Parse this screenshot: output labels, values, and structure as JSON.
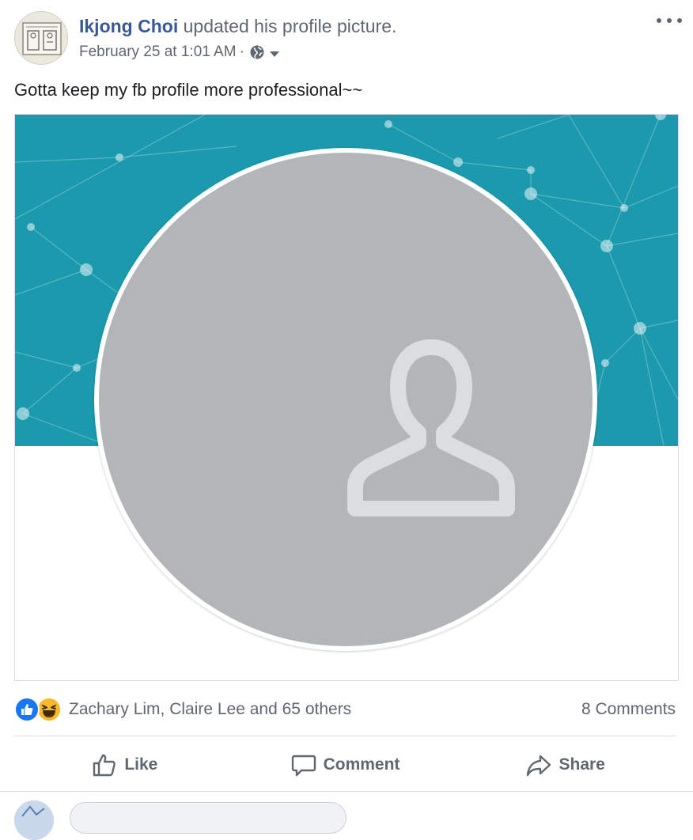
{
  "post": {
    "author_name": "Ikjong Choi",
    "author_action": " updated his profile picture.",
    "date": "February 25 at 1:01 AM",
    "separator": "·",
    "privacy_icon": "globe-icon",
    "text": "Gotta keep my fb profile more professional~~"
  },
  "photo": {
    "cover_color": "#1b99ad",
    "placeholder_color": "#b3b6b8",
    "icon": "default-person-icon"
  },
  "reactions": {
    "types": [
      "like",
      "haha"
    ],
    "summary": "Zachary Lim, Claire Lee and 65 others",
    "comments": "8 Comments"
  },
  "actions": {
    "like": "Like",
    "comment": "Comment",
    "share": "Share"
  },
  "colors": {
    "link": "#385898",
    "secondary_text": "#606770",
    "like_blue": "#1877f2",
    "haha_yellow": "#f7b928"
  }
}
